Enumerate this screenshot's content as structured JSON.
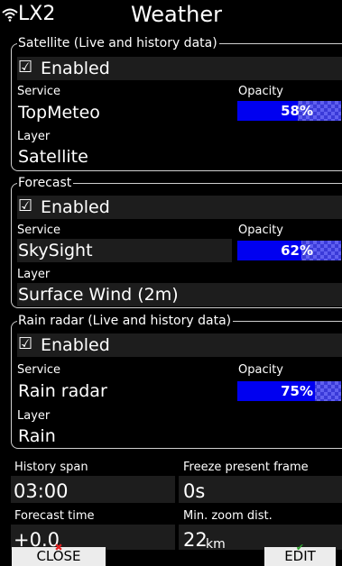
{
  "titlebar": {
    "app_name": "LX2",
    "page_title": "Weather",
    "wifi_icon": "wifi-icon"
  },
  "satellite": {
    "title": "Satellite (Live and history data)",
    "enabled_label": "Enabled",
    "service_label": "Service",
    "service_value": "TopMeteo",
    "opacity_label": "Opacity",
    "opacity_value": "58%",
    "opacity_fraction": 0.58,
    "layer_label": "Layer",
    "layer_value": "Satellite"
  },
  "forecast": {
    "title": "Forecast",
    "enabled_label": "Enabled",
    "service_label": "Service",
    "service_value": "SkySight",
    "opacity_label": "Opacity",
    "opacity_value": "62%",
    "opacity_fraction": 0.62,
    "layer_label": "Layer",
    "layer_value": "Surface Wind (2m)"
  },
  "rain": {
    "title": "Rain radar (Live and history data)",
    "enabled_label": "Enabled",
    "service_label": "Service",
    "service_value": "Rain radar",
    "opacity_label": "Opacity",
    "opacity_value": "75%",
    "opacity_fraction": 0.75,
    "layer_label": "Layer",
    "layer_value": "Rain"
  },
  "bottom": {
    "history_span_label": "History span",
    "history_span_value": "03:00",
    "freeze_label": "Freeze present frame",
    "freeze_value": "0s",
    "forecast_time_label": "Forecast time",
    "forecast_time_value": "+0.0",
    "min_zoom_label": "Min. zoom dist.",
    "min_zoom_value": "22",
    "min_zoom_unit": "km"
  },
  "buttons": {
    "close": "CLOSE",
    "edit": "EDIT"
  },
  "colors": {
    "background": "#000000",
    "field": "#1d1d1d",
    "opacity_bar": "#0000f0",
    "button": "#ececec"
  }
}
